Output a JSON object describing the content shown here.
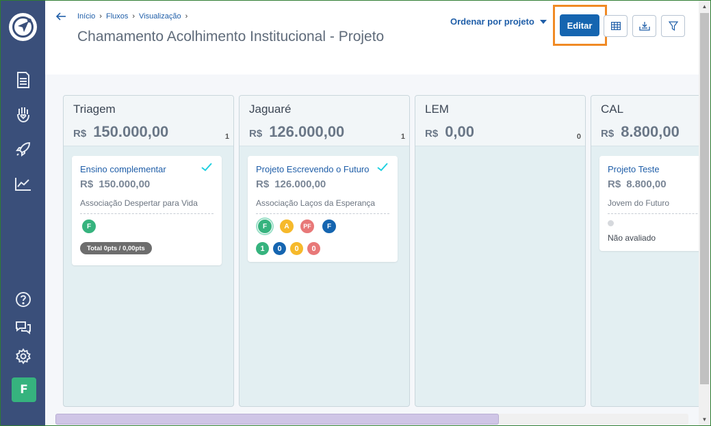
{
  "sidebar": {
    "logo_icon": "navigation-arrow-icon",
    "nav": [
      {
        "icon": "document-icon"
      },
      {
        "icon": "hand-heart-icon"
      },
      {
        "icon": "rocket-icon"
      },
      {
        "icon": "chart-line-icon"
      }
    ],
    "bottom": [
      {
        "icon": "help-icon"
      },
      {
        "icon": "chat-icon"
      },
      {
        "icon": "gear-icon"
      }
    ],
    "avatar_letter": "F",
    "colors": {
      "background": "#3a4f7a",
      "avatar": "#36b37e"
    }
  },
  "header": {
    "breadcrumb": [
      "Início",
      "Fluxos",
      "Visualização"
    ],
    "title": "Chamamento Acolhimento Institucional - Projeto",
    "sort_label": "Ordenar por projeto",
    "edit_label": "Editar",
    "tools": [
      {
        "icon": "table-icon"
      },
      {
        "icon": "download-icon"
      },
      {
        "icon": "filter-icon"
      }
    ],
    "colors": {
      "accent": "#1565b0",
      "highlight": "#f08a24"
    }
  },
  "columns": [
    {
      "name": "Triagem",
      "currency": "R$",
      "total": "150.000,00",
      "count": "1",
      "cards": [
        {
          "title": "Ensino complementar",
          "currency": "R$",
          "value": "150.000,00",
          "org": "Associação Despertar para Vida",
          "checked": true,
          "badges": [
            {
              "label": "F",
              "color": "#36b37e"
            }
          ],
          "total_pill": "Total 0pts / 0,00pts"
        }
      ]
    },
    {
      "name": "Jaguaré",
      "currency": "R$",
      "total": "126.000,00",
      "count": "1",
      "cards": [
        {
          "title": "Projeto Escrevendo o Futuro",
          "currency": "R$",
          "value": "126.000,00",
          "org": "Associação Laços da Esperança",
          "checked": true,
          "badges": [
            {
              "label": "F",
              "color": "#36b37e"
            },
            {
              "label": "A",
              "color": "#f6b92b"
            },
            {
              "label": "PF",
              "color": "#e87878"
            },
            {
              "label": "F",
              "color": "#1565b0"
            }
          ],
          "counts": [
            {
              "label": "1",
              "color": "#36b37e"
            },
            {
              "label": "0",
              "color": "#1565b0"
            },
            {
              "label": "0",
              "color": "#f6b92b"
            },
            {
              "label": "0",
              "color": "#e87878"
            }
          ]
        }
      ]
    },
    {
      "name": "LEM",
      "currency": "R$",
      "total": "0,00",
      "count": "0",
      "cards": []
    },
    {
      "name": "CAL",
      "currency": "R$",
      "total": "8.800,00",
      "count": "",
      "cards": [
        {
          "title": "Projeto Teste",
          "currency": "R$",
          "value": "8.800,00",
          "org": "Jovem do Futuro",
          "status": "Não avaliado"
        }
      ]
    }
  ]
}
